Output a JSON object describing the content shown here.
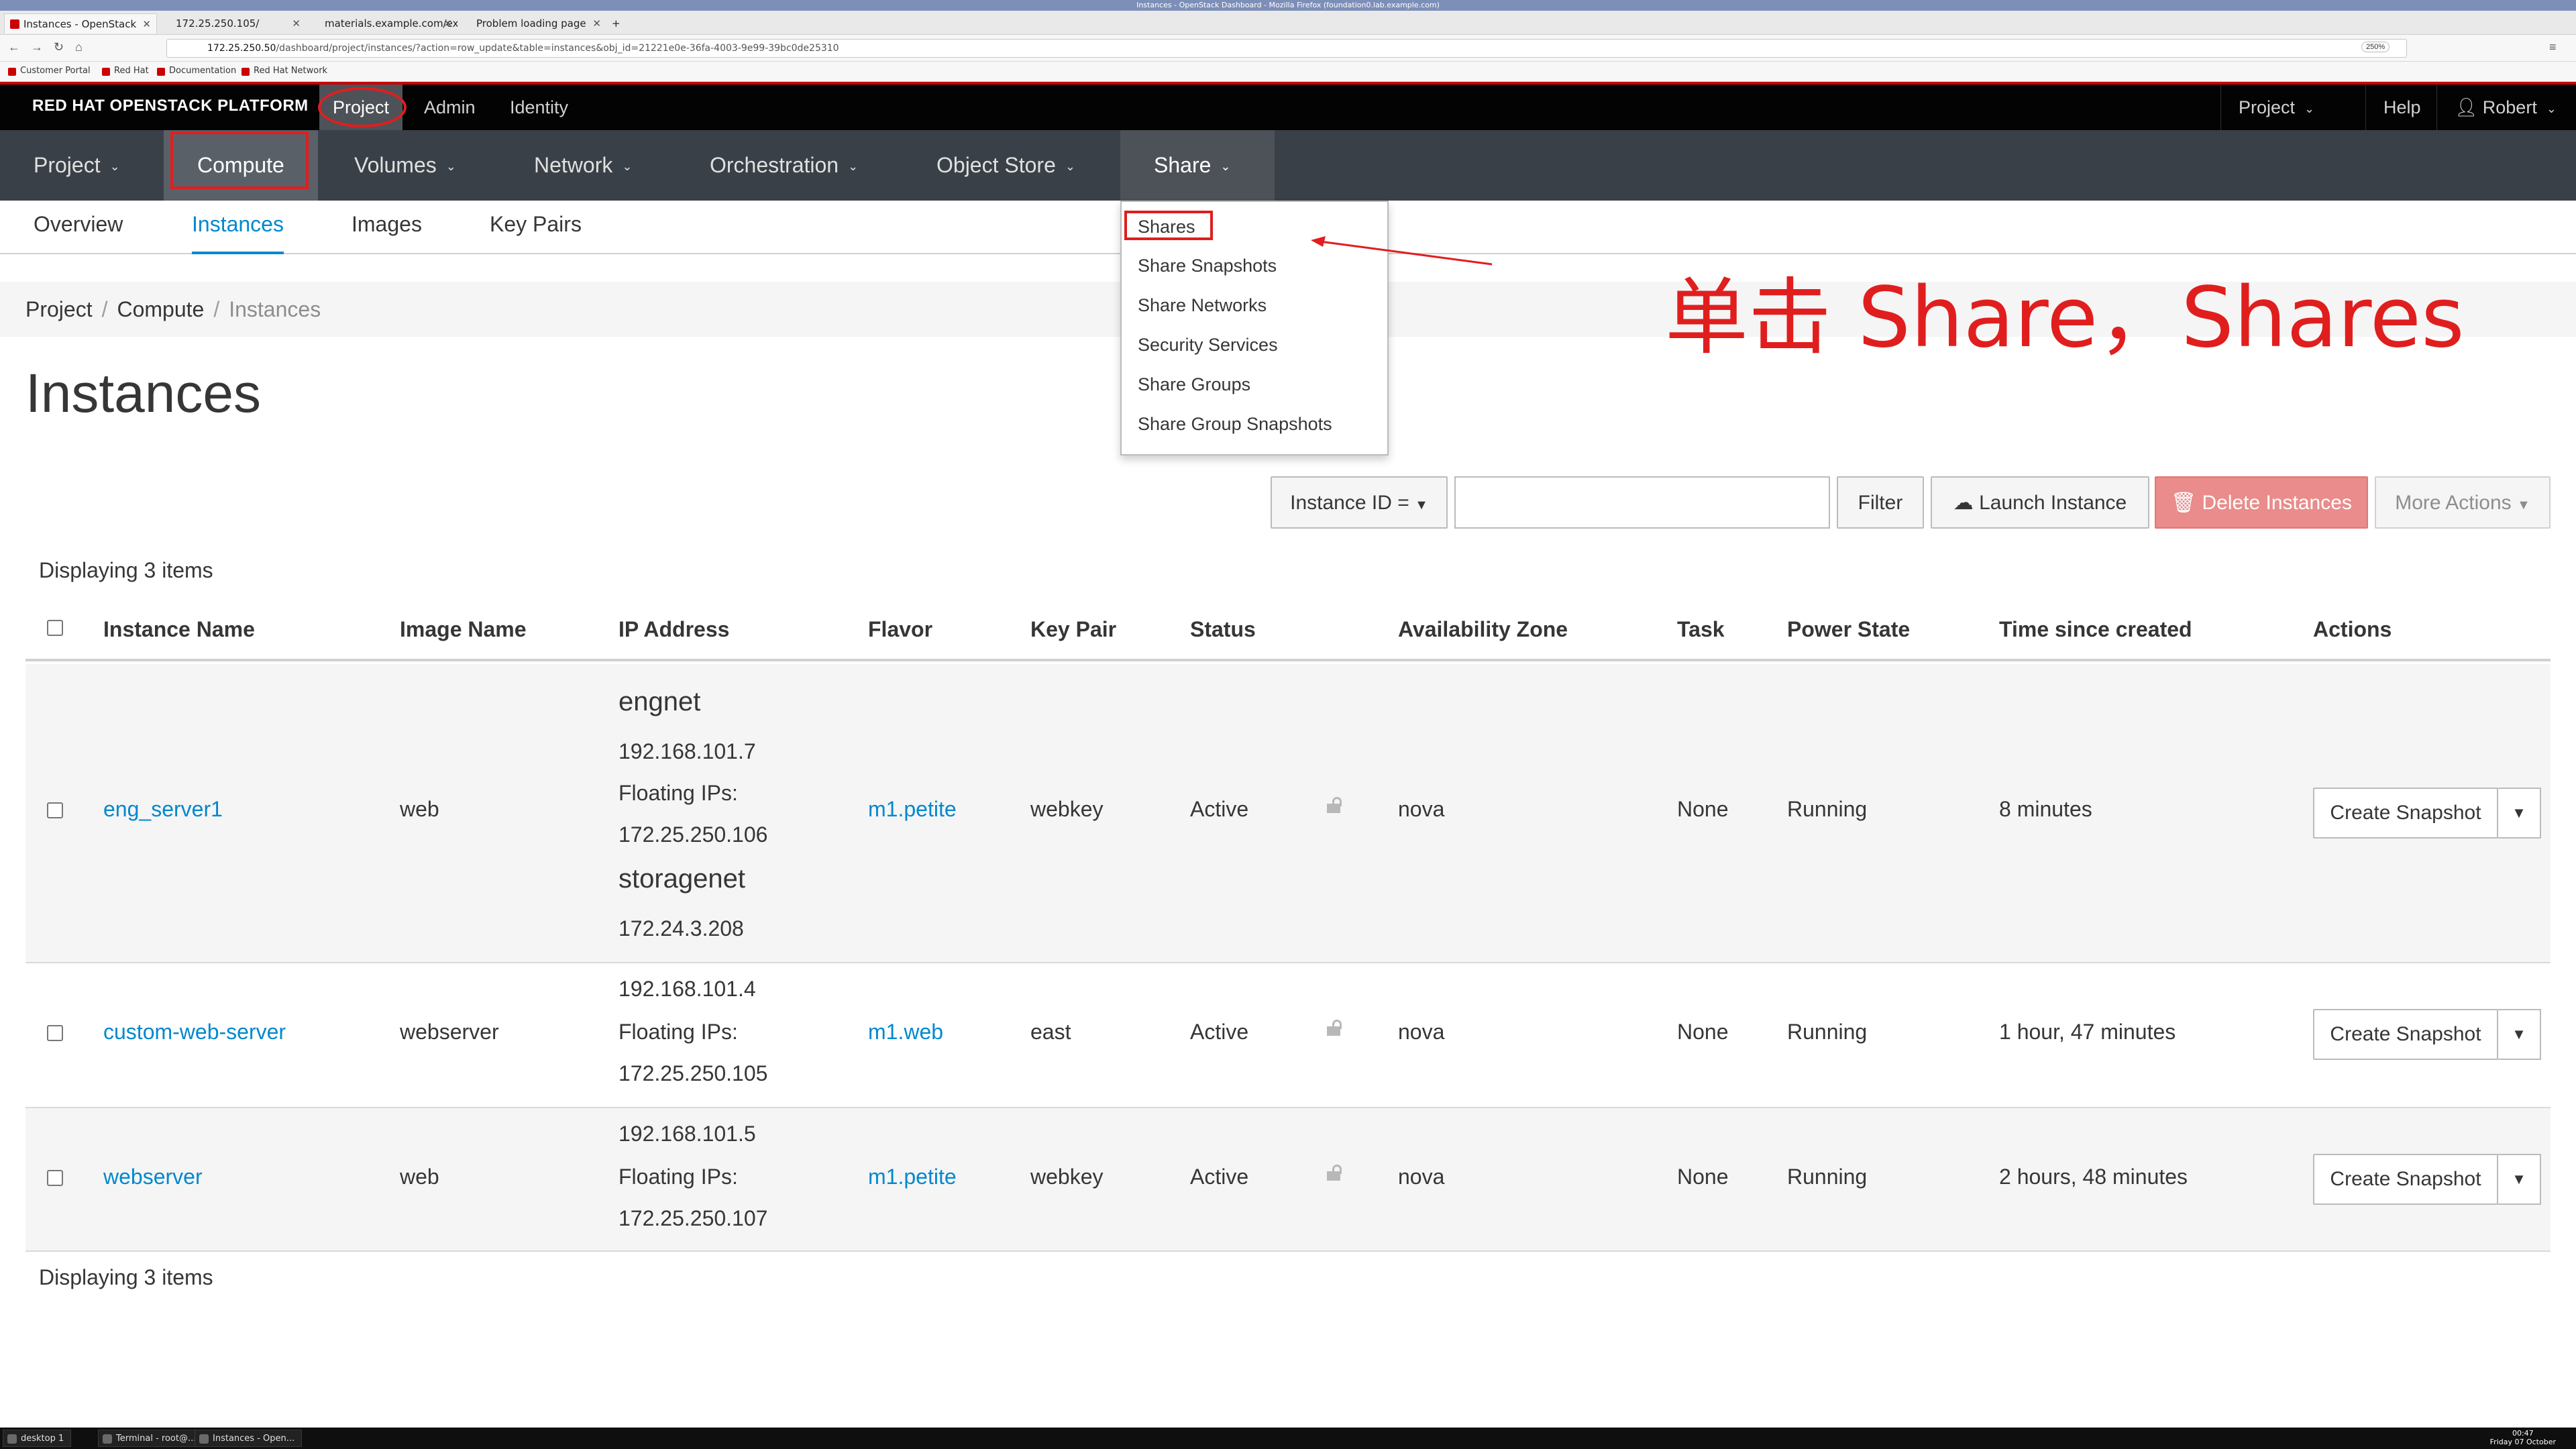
{
  "window_title": "Instances - OpenStack Dashboard - Mozilla Firefox (foundation0.lab.example.com)",
  "browser": {
    "tabs": [
      {
        "label": "Instances - OpenStack",
        "active": true
      },
      {
        "label": "172.25.250.105/",
        "active": false
      },
      {
        "label": "materials.example.com/ex",
        "active": false
      },
      {
        "label": "Problem loading page",
        "active": false
      }
    ],
    "new_tab": "+",
    "url_host": "172.25.250.50",
    "url_path": "/dashboard/project/instances/?action=row_update&table=instances&obj_id=21221e0e-36fa-4003-9e99-39bc0de25310",
    "zoom": "250%",
    "back": "←",
    "forward": "→",
    "reload": "↻",
    "home": "⌂",
    "menu": "≡",
    "bookmarks": [
      "Customer Portal",
      "Red Hat",
      "Documentation",
      "Red Hat Network"
    ]
  },
  "header": {
    "brand": "RED HAT OPENSTACK PLATFORM",
    "nav": [
      "Project",
      "Admin",
      "Identity"
    ],
    "right": {
      "project": "Project",
      "help": "Help",
      "user": "Robert"
    }
  },
  "secondary_nav": [
    "Project",
    "Compute",
    "Volumes",
    "Network",
    "Orchestration",
    "Object Store",
    "Share"
  ],
  "tertiary_nav": [
    "Overview",
    "Instances",
    "Images",
    "Key Pairs"
  ],
  "share_menu": [
    "Shares",
    "Share Snapshots",
    "Share Networks",
    "Security Services",
    "Share Groups",
    "Share Group Snapshots"
  ],
  "breadcrumb": [
    "Project",
    "Compute",
    "Instances"
  ],
  "page_title": "Instances",
  "toolbar": {
    "filter_select": "Instance ID =",
    "filter_input_value": "",
    "filter_button": "Filter",
    "launch_button": "Launch Instance",
    "delete_button": "Delete Instances",
    "more_actions": "More Actions"
  },
  "displaying_text": "Displaying 3 items",
  "table": {
    "columns": [
      "Instance Name",
      "Image Name",
      "IP Address",
      "Flavor",
      "Key Pair",
      "Status",
      "Availability Zone",
      "Task",
      "Power State",
      "Time since created",
      "Actions"
    ],
    "rows": [
      {
        "name": "eng_server1",
        "image": "web",
        "ip": {
          "net1": "engnet",
          "ip1": "192.168.101.7",
          "floating_label": "Floating IPs:",
          "floating": "172.25.250.106",
          "net2": "storagenet",
          "ip2": "172.24.3.208"
        },
        "flavor": "m1.petite",
        "keypair": "webkey",
        "status": "Active",
        "zone": "nova",
        "task": "None",
        "power": "Running",
        "age": "8 minutes",
        "action": "Create Snapshot"
      },
      {
        "name": "custom-web-server",
        "image": "webserver",
        "ip": {
          "ip1": "192.168.101.4",
          "floating_label": "Floating IPs:",
          "floating": "172.25.250.105"
        },
        "flavor": "m1.web",
        "keypair": "east",
        "status": "Active",
        "zone": "nova",
        "task": "None",
        "power": "Running",
        "age": "1 hour, 47 minutes",
        "action": "Create Snapshot"
      },
      {
        "name": "webserver",
        "image": "web",
        "ip": {
          "ip1": "192.168.101.5",
          "floating_label": "Floating IPs:",
          "floating": "172.25.250.107"
        },
        "flavor": "m1.petite",
        "keypair": "webkey",
        "status": "Active",
        "zone": "nova",
        "task": "None",
        "power": "Running",
        "age": "2 hours, 48 minutes",
        "action": "Create Snapshot"
      }
    ]
  },
  "annotation": "单击 Share，Shares",
  "annotation_color": "#e01e1e",
  "taskbar": {
    "items": [
      "desktop 1",
      "Terminal - root@...",
      "Instances - Open..."
    ],
    "clock_time": "00:47",
    "clock_date": "Friday 07 October"
  }
}
